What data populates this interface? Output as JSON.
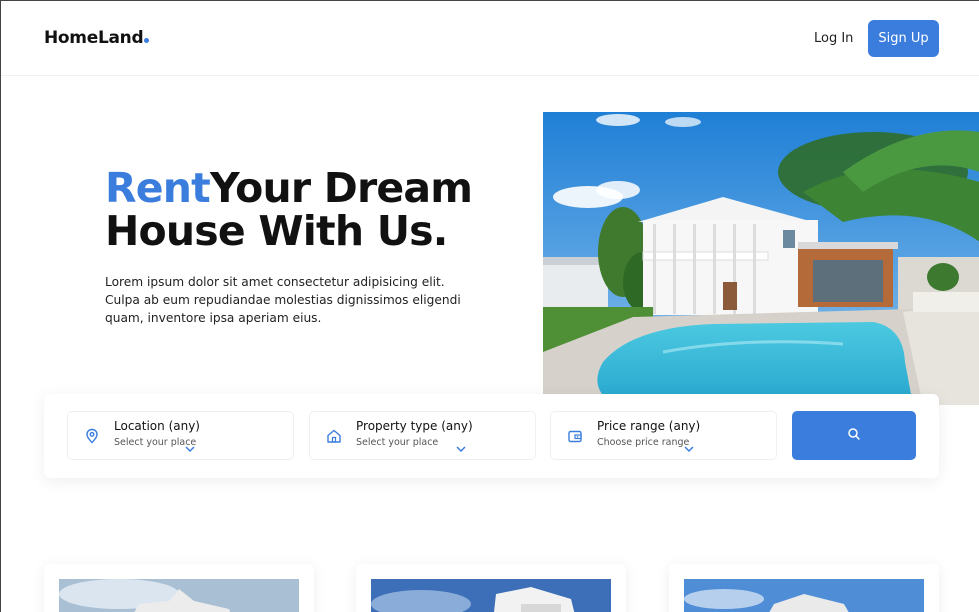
{
  "nav": {
    "logo": "HomeLand",
    "login_label": "Log In",
    "signup_label": "Sign Up"
  },
  "hero": {
    "title_accent": "Rent",
    "title_line1_rest": "Your Dream",
    "title_line2": "House With Us.",
    "description": "Lorem ipsum dolor sit amet consectetur adipisicing elit. Culpa ab eum repudiandae molestias dignissimos eligendi quam, inventore ipsa aperiam eius."
  },
  "search": {
    "fields": [
      {
        "title": "Location (any)",
        "subtitle": "Select your place",
        "icon": "location-pin-icon"
      },
      {
        "title": "Property type (any)",
        "subtitle": "Select your place",
        "icon": "house-icon"
      },
      {
        "title": "Price range (any)",
        "subtitle": "Choose price range",
        "icon": "wallet-icon"
      }
    ],
    "button_icon": "search-icon"
  },
  "colors": {
    "accent": "#3b7ddd",
    "text": "#111111"
  }
}
